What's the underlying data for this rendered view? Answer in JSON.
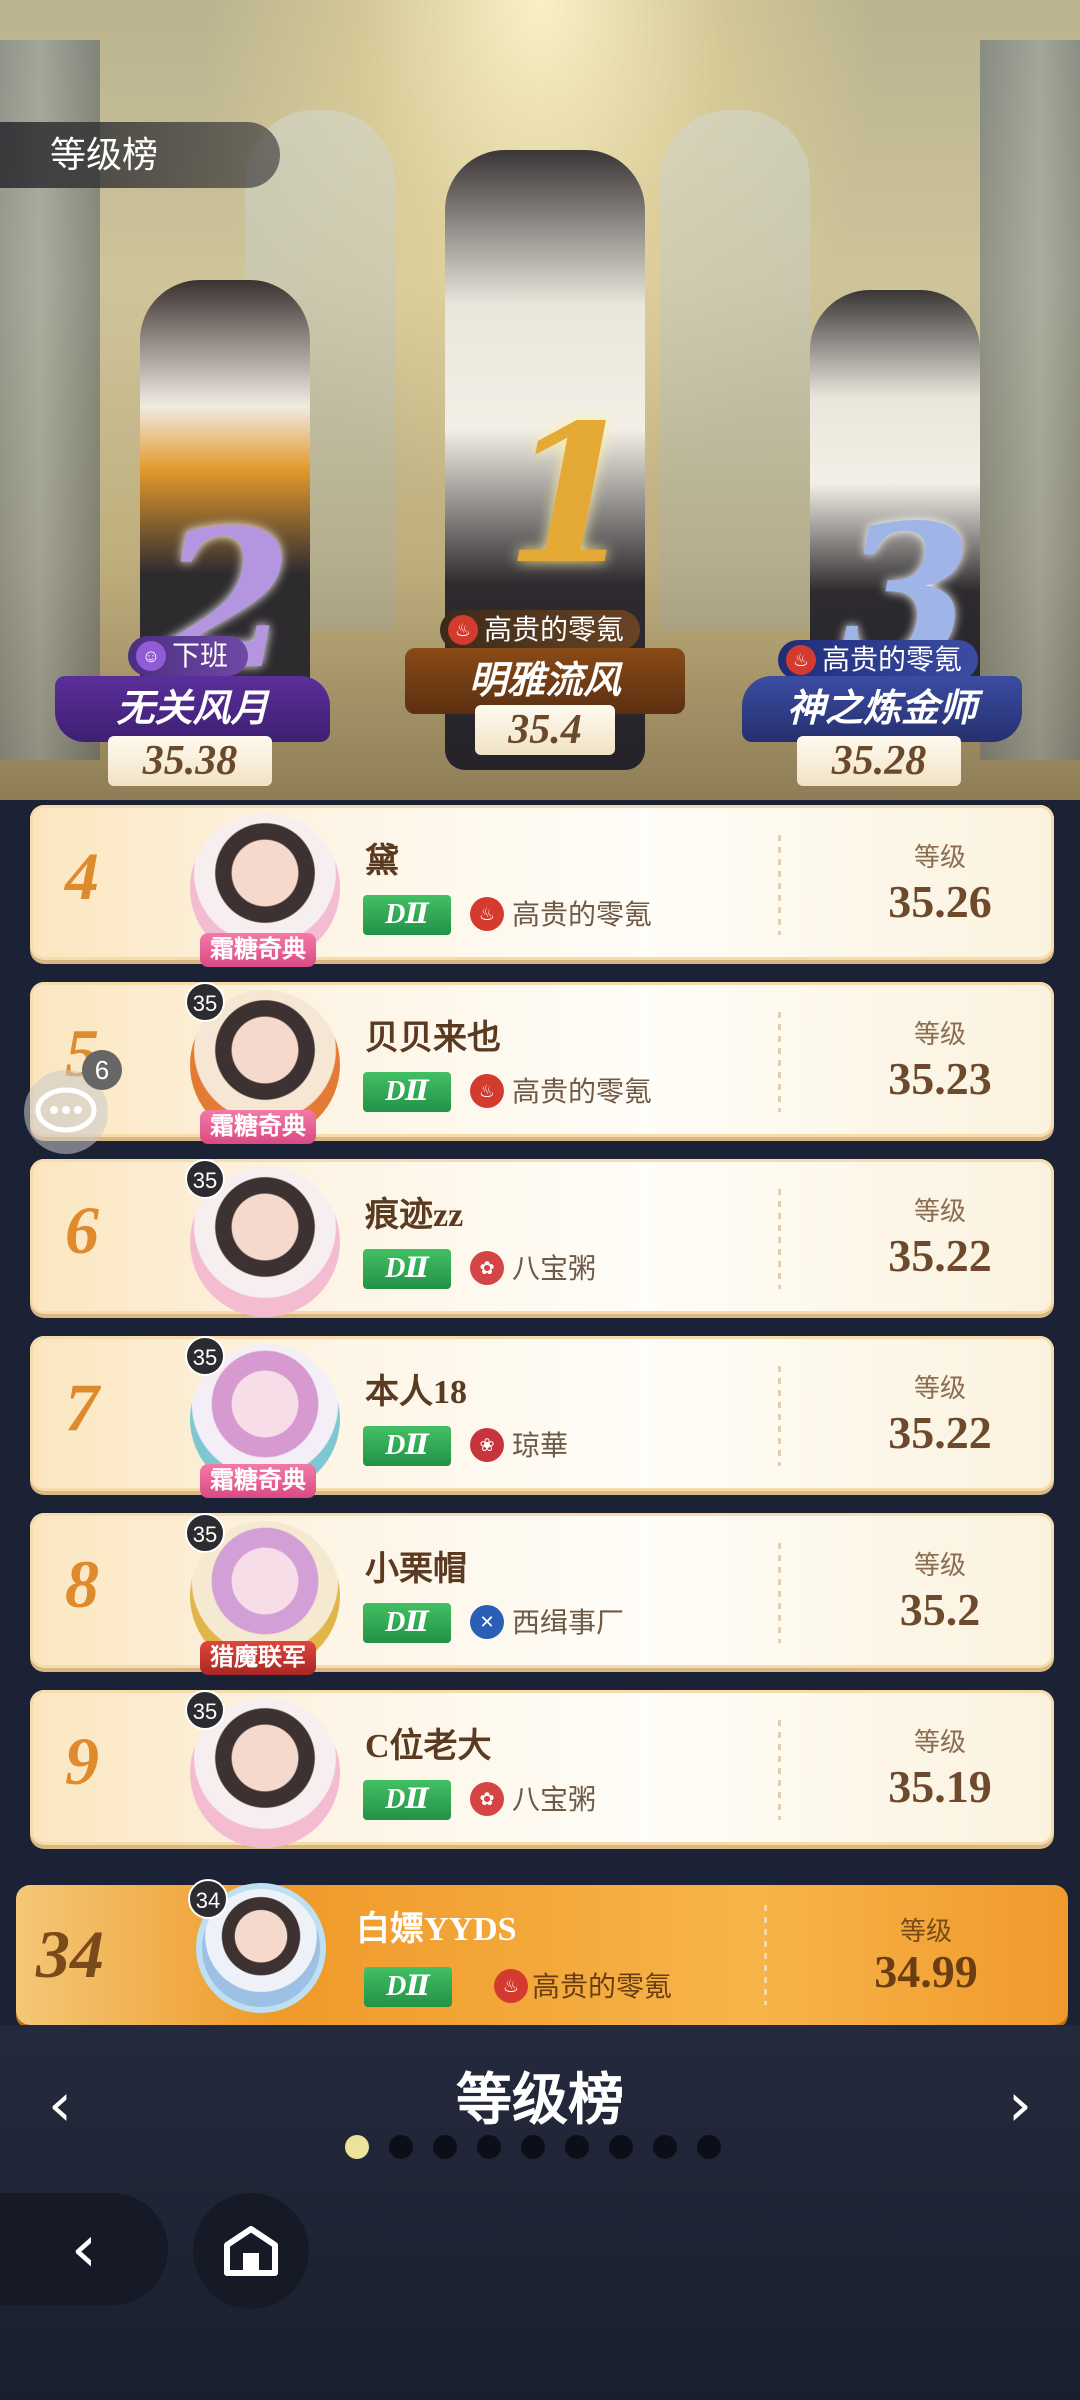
{
  "header": {
    "title": "等级榜"
  },
  "podium": [
    {
      "rank": "1",
      "guild": "高贵的零氪",
      "name": "明雅流风",
      "score": "35.4"
    },
    {
      "rank": "2",
      "guild": "下班",
      "name": "无关风月",
      "score": "35.38"
    },
    {
      "rank": "3",
      "guild": "高贵的零氪",
      "name": "神之炼金师",
      "score": "35.28"
    }
  ],
  "level_label": "等级",
  "badge_text": "DⅡ",
  "rows": [
    {
      "rank": "4",
      "avatar_level": "35",
      "frame_tag": "霜糖奇典",
      "name": "黛",
      "guild": "高贵的零氪",
      "level": "35.26"
    },
    {
      "rank": "5",
      "avatar_level": "35",
      "frame_tag": "霜糖奇典",
      "name": "贝贝来也",
      "guild": "高贵的零氪",
      "level": "35.23"
    },
    {
      "rank": "6",
      "avatar_level": "35",
      "frame_tag": "",
      "name": "痕迹zz",
      "guild": "八宝粥",
      "level": "35.22"
    },
    {
      "rank": "7",
      "avatar_level": "35",
      "frame_tag": "霜糖奇典",
      "name": "本人18",
      "guild": "琼華",
      "level": "35.22"
    },
    {
      "rank": "8",
      "avatar_level": "35",
      "frame_tag": "猎魔联军",
      "name": "小栗帽",
      "guild": "西缉事厂",
      "level": "35.2"
    },
    {
      "rank": "9",
      "avatar_level": "35",
      "frame_tag": "",
      "name": "C位老大",
      "guild": "八宝粥",
      "level": "35.19"
    }
  ],
  "self": {
    "rank": "34",
    "avatar_level": "34",
    "name": "白嫖YYDS",
    "guild": "高贵的零氪",
    "level": "34.99"
  },
  "footer": {
    "board_name": "等级榜",
    "page_count": 9,
    "active_page": 1
  },
  "chat": {
    "unread": "6"
  },
  "colors": {
    "accent": "#e08a2e",
    "badge_green": "#2ca652",
    "self_row": "#ef9a2a"
  }
}
